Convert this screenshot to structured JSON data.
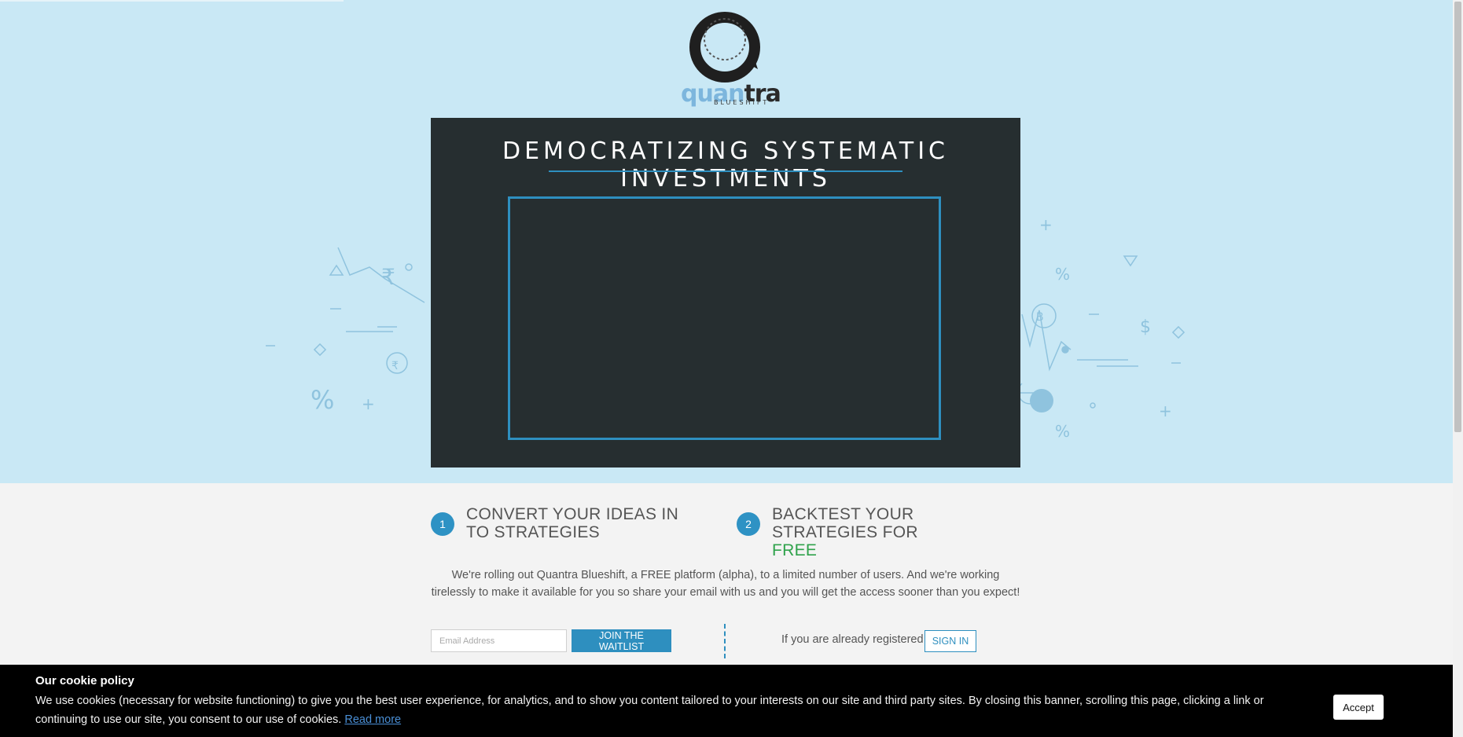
{
  "logo": {
    "word_light": "quan",
    "word_dark": "tra",
    "sub": "BLUESHIFT"
  },
  "hero": {
    "title": "DEMOCRATIZING SYSTEMATIC INVESTMENTS"
  },
  "steps": [
    {
      "num": "1",
      "text": "CONVERT YOUR IDEAS IN TO STRATEGIES"
    },
    {
      "num": "2",
      "text": "BACKTEST YOUR STRATEGIES FOR",
      "highlight": "FREE"
    }
  ],
  "description": "We're rolling out Quantra Blueshift, a FREE platform (alpha), to a limited number of users. And we're working tirelessly to make it available for you so share your email with us and you will get the access sooner than you expect!",
  "waitlist": {
    "placeholder": "Email Address",
    "button": "JOIN THE WAITLIST"
  },
  "signin": {
    "prompt": "If you are already registered",
    "button": "SIGN IN"
  },
  "cookie": {
    "title": "Our cookie policy",
    "text": "We use cookies (necessary for website functioning) to give you the best user experience, for analytics, and to show you content tailored to your interests on our site and third party sites. By closing this banner, scrolling this page, clicking a link or continuing to use our site, you consent to our use of cookies.",
    "link": "Read more",
    "accept": "Accept"
  },
  "colors": {
    "hero_bg": "#c9e8f5",
    "panel_bg": "#262e30",
    "accent": "#2e8fbf",
    "free": "#2fa24b"
  }
}
